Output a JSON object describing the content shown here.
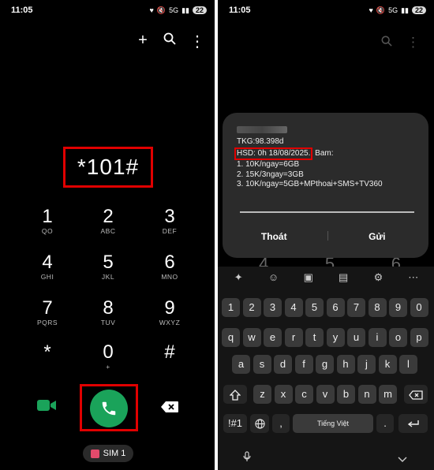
{
  "status": {
    "time_left": "11:05",
    "time_right": "11:05",
    "battery": "22",
    "net": "5G"
  },
  "dialer": {
    "number": "*101#",
    "keys": [
      {
        "d": "1",
        "l": "QO"
      },
      {
        "d": "2",
        "l": "ABC"
      },
      {
        "d": "3",
        "l": "DEF"
      },
      {
        "d": "4",
        "l": "GHI"
      },
      {
        "d": "5",
        "l": "JKL"
      },
      {
        "d": "6",
        "l": "MNO"
      },
      {
        "d": "7",
        "l": "PQRS"
      },
      {
        "d": "8",
        "l": "TUV"
      },
      {
        "d": "9",
        "l": "WXYZ"
      },
      {
        "d": "*",
        "l": ""
      },
      {
        "d": "0",
        "l": "+"
      },
      {
        "d": "#",
        "l": ""
      }
    ],
    "sim_label": "SIM 1"
  },
  "ussd": {
    "line1": "TKG:98.398d",
    "hsd": "HSD: 0h 18/08/2025.",
    "hsd_tail": " Bam:",
    "line3": "1. 10K/ngay=6GB",
    "line4": "2. 15K/3ngay=3GB",
    "line5": "3. 10K/ngay=5GB+MPthoai+SMS+TV360",
    "cancel": "Thoát",
    "send": "Gửi",
    "bg_digits": [
      "4",
      "5",
      "6"
    ]
  },
  "keyboard": {
    "row1": [
      "1",
      "2",
      "3",
      "4",
      "5",
      "6",
      "7",
      "8",
      "9",
      "0"
    ],
    "row2": [
      "q",
      "w",
      "e",
      "r",
      "t",
      "y",
      "u",
      "i",
      "o",
      "p"
    ],
    "row3": [
      "a",
      "s",
      "d",
      "f",
      "g",
      "h",
      "j",
      "k",
      "l"
    ],
    "row4": [
      "z",
      "x",
      "c",
      "v",
      "b",
      "n",
      "m"
    ],
    "sym": "!#1",
    "comma": ",",
    "space": "Tiếng Việt",
    "period": "."
  },
  "colors": {
    "call_green": "#1aa35a",
    "highlight_red": "#e00000",
    "video_green": "#1aa35a"
  }
}
